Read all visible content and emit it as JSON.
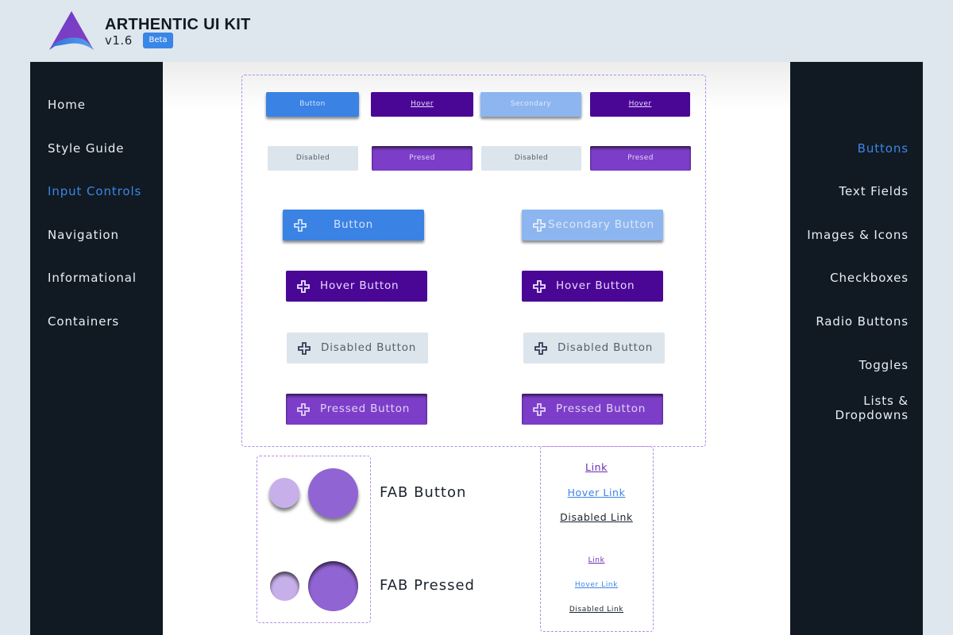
{
  "header": {
    "brand": "ARTHENTIC UI KIT",
    "version": "v1.6",
    "badge": "Beta"
  },
  "left_nav": {
    "items": [
      {
        "label": "Home",
        "active": false
      },
      {
        "label": "Style Guide",
        "active": false
      },
      {
        "label": "Input Controls",
        "active": true
      },
      {
        "label": "Navigation",
        "active": false
      },
      {
        "label": "Informational",
        "active": false
      },
      {
        "label": "Containers",
        "active": false
      }
    ]
  },
  "right_nav": {
    "items": [
      {
        "label": "Buttons",
        "active": true
      },
      {
        "label": "Text Fields",
        "active": false
      },
      {
        "label": "Images & Icons",
        "active": false
      },
      {
        "label": "Checkboxes",
        "active": false
      },
      {
        "label": "Radio Buttons",
        "active": false
      },
      {
        "label": "Toggles",
        "active": false
      },
      {
        "label_line1": "Lists &",
        "label_line2": "Dropdowns",
        "active": false
      }
    ]
  },
  "buttons": {
    "small_row1": [
      "Button",
      "Hover",
      "Secondary",
      "Hover"
    ],
    "small_row2": [
      "Disabled",
      "Presed",
      "Disabled",
      "Presed"
    ],
    "large": {
      "button": "Button",
      "secondary": "Secondary Button",
      "hover": "Hover Button",
      "disabled": "Disabled Button",
      "pressed": "Pressed Button"
    }
  },
  "fab": {
    "button_label": "FAB Button",
    "pressed_label": "FAB Pressed"
  },
  "links": {
    "large": [
      "Link",
      "Hover Link",
      "Disabled Link"
    ],
    "small": [
      "Link",
      "Hover Link",
      "Disabled Link"
    ]
  },
  "colors": {
    "accent_blue": "#3a86e6",
    "purple_dark": "#4a0795",
    "purple_pressed": "#7c3ec8",
    "sidebar_bg": "#111a22",
    "page_bg": "#dee6ee"
  }
}
